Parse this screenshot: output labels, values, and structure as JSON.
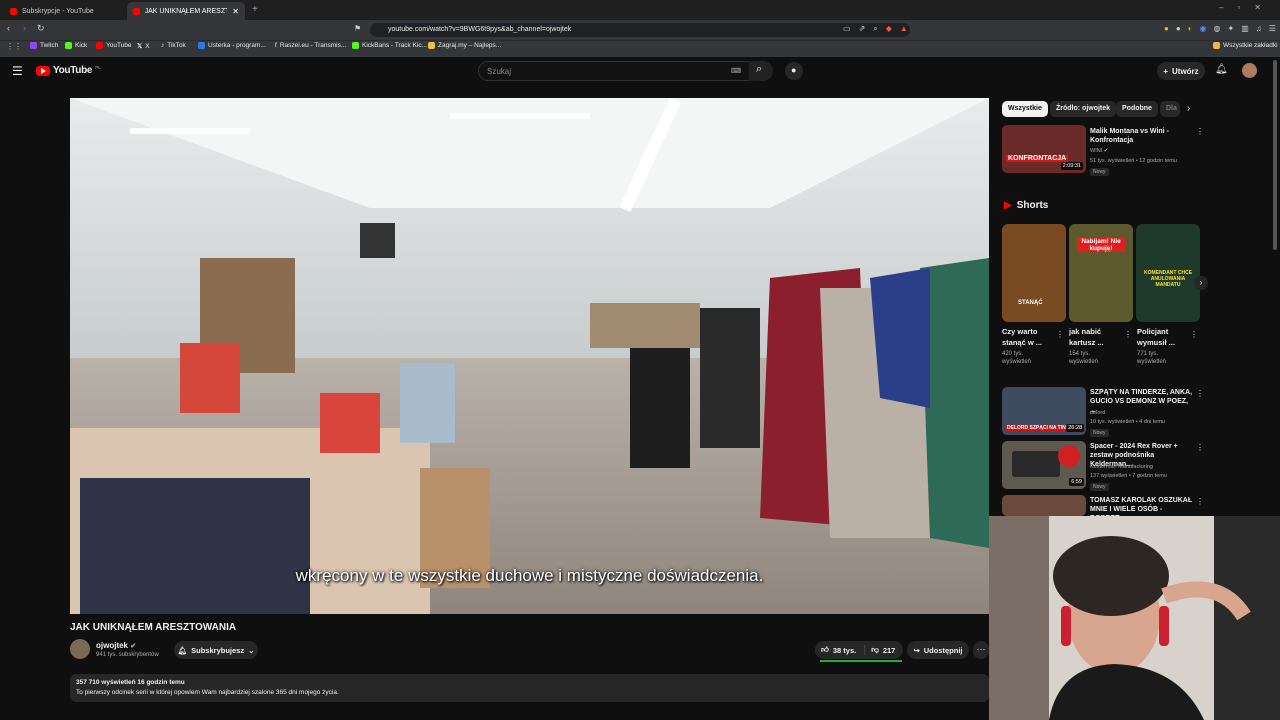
{
  "browser": {
    "tabs": [
      {
        "title": "Subskrypcje - YouTube",
        "active": false
      },
      {
        "title": "JAK UNIKNĄŁEM ARESZTOWA",
        "active": true
      }
    ],
    "url": "youtube.com/watch?v=9BWG6t9pys&ab_channel=ojwojtek",
    "bookmarks": [
      "Twitch",
      "Kick",
      "YouTube",
      "X",
      "TikTok",
      "Usterka - program...",
      "Raszei.eu - Transmis...",
      "KickBans - Track Kic...",
      "Zagraj.my – Najleps..."
    ],
    "bookmarks_right": "Wszystkie zakładki"
  },
  "header": {
    "logo": "YouTube",
    "country": "PL",
    "search_placeholder": "Szukaj",
    "create_label": "Utwórz"
  },
  "video": {
    "subtitle": "wkręcony w te wszystkie duchowe i mistyczne doświadczenia.",
    "title": "JAK UNIKNĄŁEM ARESZTOWANIA",
    "channel": "ojwojtek",
    "subscribers": "941 tys. subskrybentów",
    "subscribe_label": "Subskrybujesz",
    "likes": "38 tys.",
    "dislikes": "217",
    "share_label": "Udostępnij",
    "views_time": "357 710 wyświetleń  16 godzin temu",
    "description": "To pierwszy odcinek serii w której opowiem Wam najbardziej szalone 365 dni mojego życia."
  },
  "sidebar": {
    "chips": [
      "Wszystkie",
      "Źródło: ojwojtek",
      "Podobne",
      "Dla"
    ],
    "recommended_top": {
      "title": "Malik Montana vs Wini - Konfrontacja",
      "channel": "WINI",
      "meta": "51 tys. wyświetleń • 12 godzin temu",
      "badge": "Nowy",
      "duration": "2:09:31",
      "thumb_text": "KONFRONTACJA"
    },
    "shorts_label": "Shorts",
    "shorts": [
      {
        "title": "Czy warto stanąć w ...",
        "views": "420 tys. wyświetleń",
        "thumb_text": "STANĄĆ"
      },
      {
        "title": "jak nabić kartusz ...",
        "views": "154 tys. wyświetleń",
        "thumb_text": "Nabijam! Nie kupuję!"
      },
      {
        "title": "Policjant wymusił ...",
        "views": "771 tys. wyświetleń",
        "thumb_text": "KOMENDANT CHCE ANULOWANIA MANDATU"
      }
    ],
    "recommended": [
      {
        "title": "SZPĄTY NA TINDERZE, ANKA, GUCIO VS DEMONZ W POEZ, ...",
        "channel": "delord",
        "meta": "10 tys. wyświetleń • 4 dni temu",
        "badge": "Nowy",
        "duration": "26:28",
        "thumb_text": "DELORD SZPĄCI NA TINDERZE"
      },
      {
        "title": "Spacer - 2024 Rex Rover + zestaw podnośnika Kelderman...",
        "channel": "Kelderman Manufacturing",
        "meta": "137 wyświetleń • 7 godzin temu",
        "badge": "Nowy",
        "duration": "6:59",
        "thumb_text": ""
      },
      {
        "title": "TOMASZ KAROLAK OSZUKAŁ MNIE I WIELE OSÓB - ROBERT...",
        "channel": "",
        "meta": "",
        "badge": "",
        "duration": "",
        "thumb_text": ""
      }
    ]
  }
}
